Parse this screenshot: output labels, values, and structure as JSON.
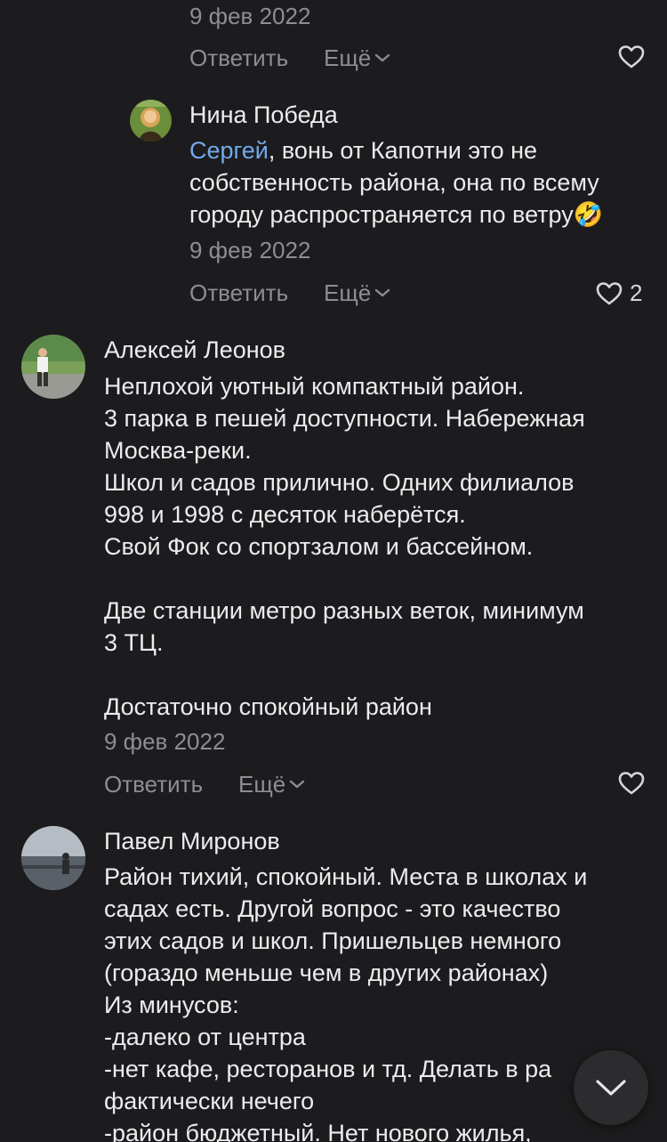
{
  "comments": [
    {
      "date": "9 фев 2022",
      "reply_label": "Ответить",
      "more_label": "Ещё",
      "likes": ""
    },
    {
      "author": "Нина Победа",
      "mention": "Сергей",
      "lines": [
        ", вонь от Капотни это не",
        "собственность района, она по всему",
        "городу распространяется по ветру🤣"
      ],
      "date": "9 фев 2022",
      "reply_label": "Ответить",
      "more_label": "Ещё",
      "likes": "2"
    },
    {
      "author": "Алексей Леонов",
      "lines": [
        "Неплохой уютный компактный район.",
        "3 парка в пешей доступности. Набережная",
        "Москва-реки.",
        "Школ и садов прилично. Одних филиалов",
        "998 и 1998 с десяток наберётся.",
        "Свой Фок со спортзалом и бассейном.",
        "",
        "Две станции метро разных веток, минимум",
        "3 ТЦ.",
        "",
        "Достаточно спокойный район"
      ],
      "date": "9 фев 2022",
      "reply_label": "Ответить",
      "more_label": "Ещё",
      "likes": ""
    },
    {
      "author": "Павел Миронов",
      "lines": [
        "Район тихий, спокойный. Места в школах и",
        "садах есть. Другой вопрос - это качество",
        "этих садов и школ. Пришельцев немного",
        "(гораздо меньше чем в других районах)",
        "Из минусов:",
        "-далеко от центра",
        "-нет кафе, ресторанов и тд. Делать в ра",
        "фактически нечего",
        "-район бюджетный. Нет нового жилья,"
      ]
    }
  ],
  "icons": {
    "heart": "heart-outline-icon",
    "chevron": "chevron-down-icon",
    "scroll": "scroll-down-icon"
  },
  "colors": {
    "background": "#1c1c1e",
    "mention": "#71aaeb",
    "secondary_text": "#8d8d93"
  }
}
